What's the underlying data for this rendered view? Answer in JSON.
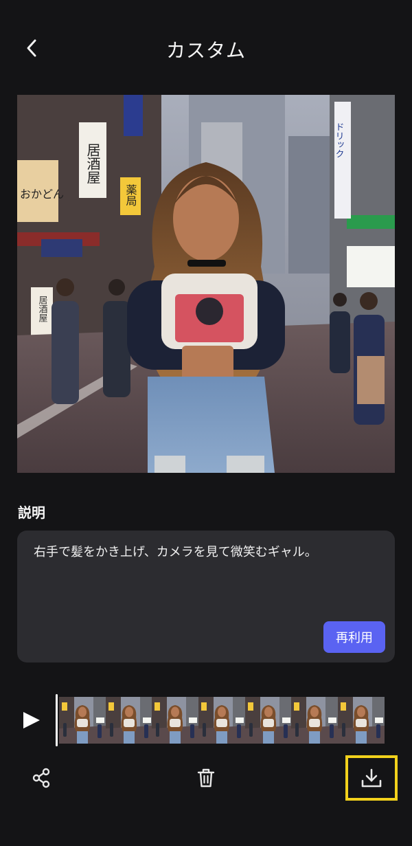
{
  "header": {
    "title": "カスタム",
    "back_icon": "chevron-left-icon"
  },
  "description": {
    "label": "説明",
    "text": "右手で髪をかき上げ、カメラを見て微笑むギャル。",
    "reuse_label": "再利用"
  },
  "image_signs": {
    "sign_1": "居酒屋",
    "sign_2": "薬局",
    "sign_3": "おかどん",
    "sign_4": "ドリック",
    "sign_5": "居酒屋"
  },
  "timeline": {
    "play_icon": "play-icon",
    "frame_count": 7
  },
  "toolbar": {
    "share_icon": "share-icon",
    "delete_icon": "trash-icon",
    "download_icon": "download-icon"
  },
  "colors": {
    "background": "#141416",
    "panel": "#2c2c30",
    "accent": "#5a63f2",
    "highlight": "#f2d11c"
  }
}
